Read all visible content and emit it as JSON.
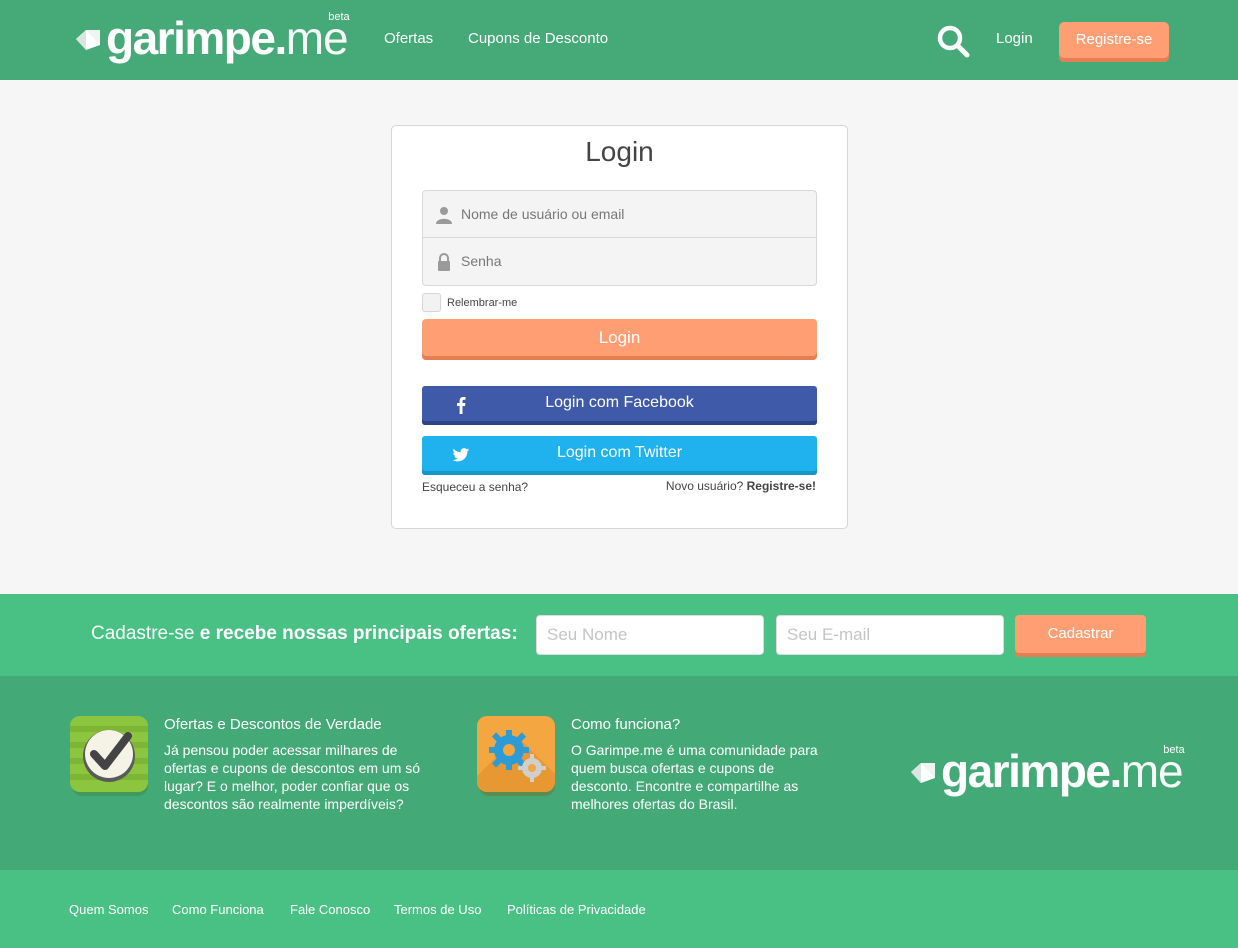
{
  "header": {
    "logo": {
      "bold": "garimpe.",
      "thin": "me",
      "beta": "beta"
    },
    "nav": [
      {
        "label": "Ofertas"
      },
      {
        "label": "Cupons de Desconto"
      }
    ],
    "login_label": "Login",
    "register_label": "Registre-se"
  },
  "login_card": {
    "title": "Login",
    "username_placeholder": "Nome de usuário ou email",
    "password_placeholder": "Senha",
    "remember_label": "Relembrar-me",
    "login_button": "Login",
    "facebook_button": "Login com Facebook",
    "twitter_button": "Login com Twitter",
    "forgot_password": "Esqueceu a senha?",
    "new_user_prefix": "Novo usuário?",
    "new_user_link": "Registre-se!"
  },
  "newsletter": {
    "label_light": "Cadastre-se",
    "label_bold": "e recebe nossas principais ofertas:",
    "name_placeholder": "Seu Nome",
    "email_placeholder": "Seu E-mail",
    "submit_label": "Cadastrar"
  },
  "info": {
    "blocks": [
      {
        "title": "Ofertas e Descontos de Verdade",
        "text": "Já pensou poder acessar milhares de ofertas e cupons de descontos em um só lugar? E o melhor, poder confiar que os descontos são realmente imperdíveis?",
        "icon": "checkmark-icon"
      },
      {
        "title": "Como funciona?",
        "text": "O Garimpe.me é uma comunidade para quem busca ofertas e cupons de desconto. Encontre e compartilhe as melhores ofertas do Brasil.",
        "icon": "gears-icon"
      }
    ],
    "logo": {
      "bold": "garimpe.",
      "thin": "me",
      "beta": "beta"
    }
  },
  "footer_links": [
    {
      "label": "Quem Somos"
    },
    {
      "label": "Como Funciona"
    },
    {
      "label": "Fale Conosco"
    },
    {
      "label": "Termos de Uso"
    },
    {
      "label": "Políticas de Privacidade"
    }
  ],
  "colors": {
    "header_green": "#45aa78",
    "light_green": "#4ac184",
    "accent_orange": "#fe9e72",
    "facebook_blue": "#3f5aa8",
    "twitter_blue": "#1fb2ee"
  }
}
